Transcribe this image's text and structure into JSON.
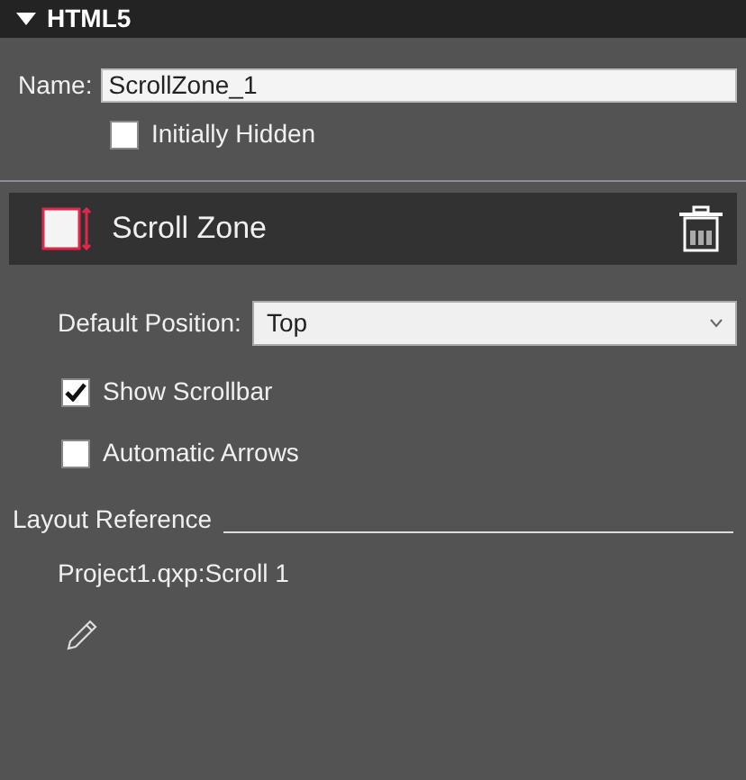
{
  "section": {
    "title": "HTML5",
    "expanded": true
  },
  "name_field": {
    "label": "Name:",
    "value": "ScrollZone_1"
  },
  "initially_hidden": {
    "label": "Initially Hidden",
    "checked": false
  },
  "component": {
    "title": "Scroll Zone"
  },
  "default_position": {
    "label": "Default Position:",
    "value": "Top"
  },
  "options": [
    {
      "label": "Show Scrollbar",
      "checked": true
    },
    {
      "label": "Automatic Arrows",
      "checked": false
    }
  ],
  "layout_reference": {
    "title": "Layout Reference",
    "value": "Project1.qxp:Scroll 1"
  }
}
